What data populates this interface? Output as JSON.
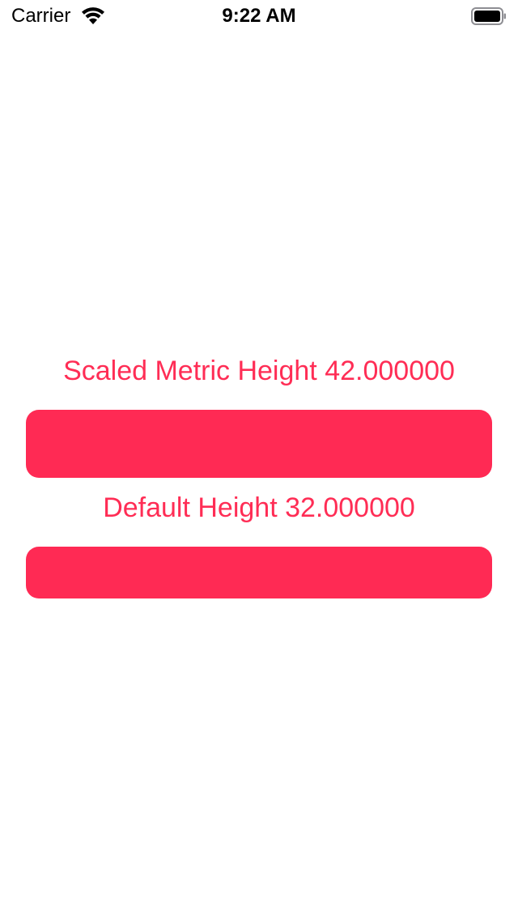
{
  "status_bar": {
    "carrier": "Carrier",
    "time": "9:22 AM",
    "wifi_icon": "wifi-icon",
    "battery_icon": "battery-full-icon"
  },
  "main": {
    "scaled_label": "Scaled Metric Height 42.000000",
    "default_label": "Default Height 32.000000"
  },
  "colors": {
    "accent": "#ff2d55",
    "background": "#ffffff"
  }
}
